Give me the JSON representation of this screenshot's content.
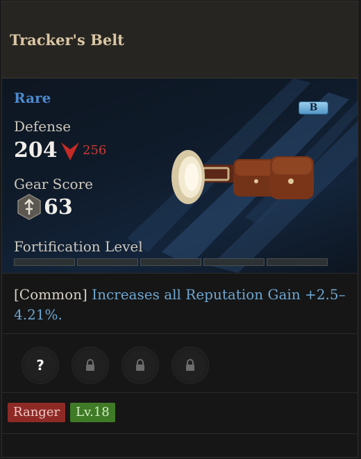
{
  "item": {
    "name": "Tracker's Belt",
    "rarity": "Rare",
    "grade": "B",
    "image": "leather belt with pouches"
  },
  "stats": {
    "defense_label": "Defense",
    "defense_value": "204",
    "defense_compare": "256",
    "gear_score_label": "Gear Score",
    "gear_score_value": "63",
    "fortification_label": "Fortification Level",
    "fortification_filled": 0,
    "fortification_total": 5
  },
  "effect": {
    "tag": "[Common]",
    "text": "Increases all Reputation Gain +2.5–4.21%."
  },
  "sockets": [
    {
      "state": "unknown",
      "symbol": "?"
    },
    {
      "state": "locked",
      "icon": "lock-icon"
    },
    {
      "state": "locked",
      "icon": "lock-icon"
    },
    {
      "state": "locked",
      "icon": "lock-icon"
    }
  ],
  "requirements": {
    "class": "Ranger",
    "level": "Lv.18"
  },
  "colors": {
    "rarity": "#4c8ad0",
    "compare_down": "#cc3b33",
    "class_tag": "#8e2a26",
    "level_tag": "#3f7a26"
  }
}
